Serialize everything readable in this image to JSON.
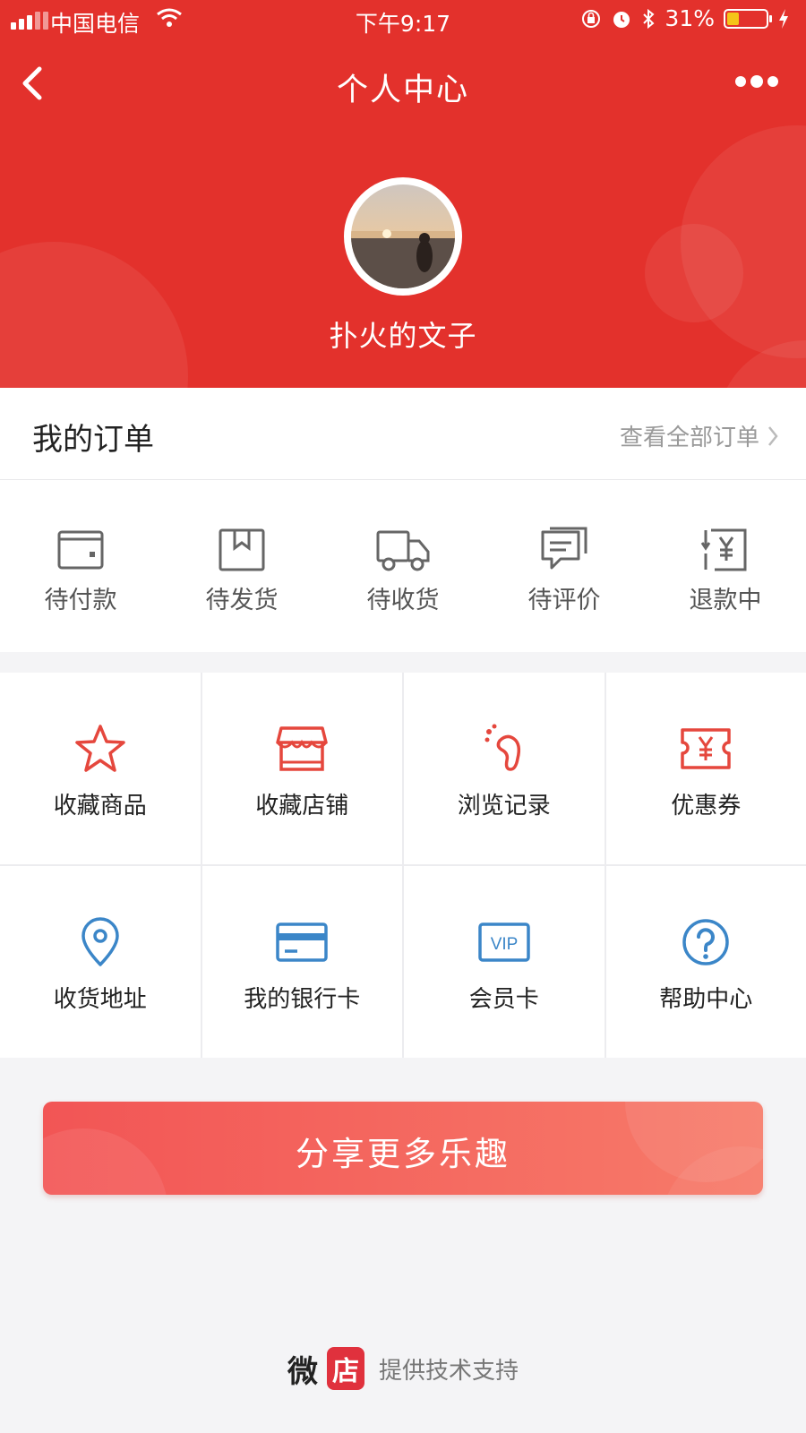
{
  "status_bar": {
    "carrier": "中国电信",
    "time": "下午9:17",
    "battery": "31%",
    "battery_level": 0.31
  },
  "nav": {
    "title": "个人中心"
  },
  "profile": {
    "username": "扑火的文子"
  },
  "orders": {
    "title": "我的订单",
    "view_all": "查看全部订单",
    "items": [
      {
        "label": "待付款",
        "icon": "wallet-icon"
      },
      {
        "label": "待发货",
        "icon": "package-icon"
      },
      {
        "label": "待收货",
        "icon": "truck-icon"
      },
      {
        "label": "待评价",
        "icon": "comment-icon"
      },
      {
        "label": "退款中",
        "icon": "refund-icon"
      }
    ]
  },
  "menu": {
    "items": [
      {
        "label": "收藏商品",
        "icon": "star-icon",
        "color": "#e5473d"
      },
      {
        "label": "收藏店铺",
        "icon": "store-icon",
        "color": "#e5473d"
      },
      {
        "label": "浏览记录",
        "icon": "footprint-icon",
        "color": "#e5473d"
      },
      {
        "label": "优惠券",
        "icon": "coupon-icon",
        "color": "#e5473d"
      },
      {
        "label": "收货地址",
        "icon": "location-icon",
        "color": "#3b86c8"
      },
      {
        "label": "我的银行卡",
        "icon": "bank-card-icon",
        "color": "#3b86c8"
      },
      {
        "label": "会员卡",
        "icon": "vip-card-icon",
        "vip_text": "VIP",
        "color": "#3b86c8"
      },
      {
        "label": "帮助中心",
        "icon": "help-icon",
        "color": "#3b86c8"
      }
    ]
  },
  "share_button": {
    "label": "分享更多乐趣"
  },
  "footer": {
    "brand_part1": "微",
    "brand_part2": "店",
    "support": "提供技术支持"
  },
  "colors": {
    "header_red": "#e3312c",
    "accent_red": "#e5473d",
    "accent_blue": "#3b86c8"
  }
}
